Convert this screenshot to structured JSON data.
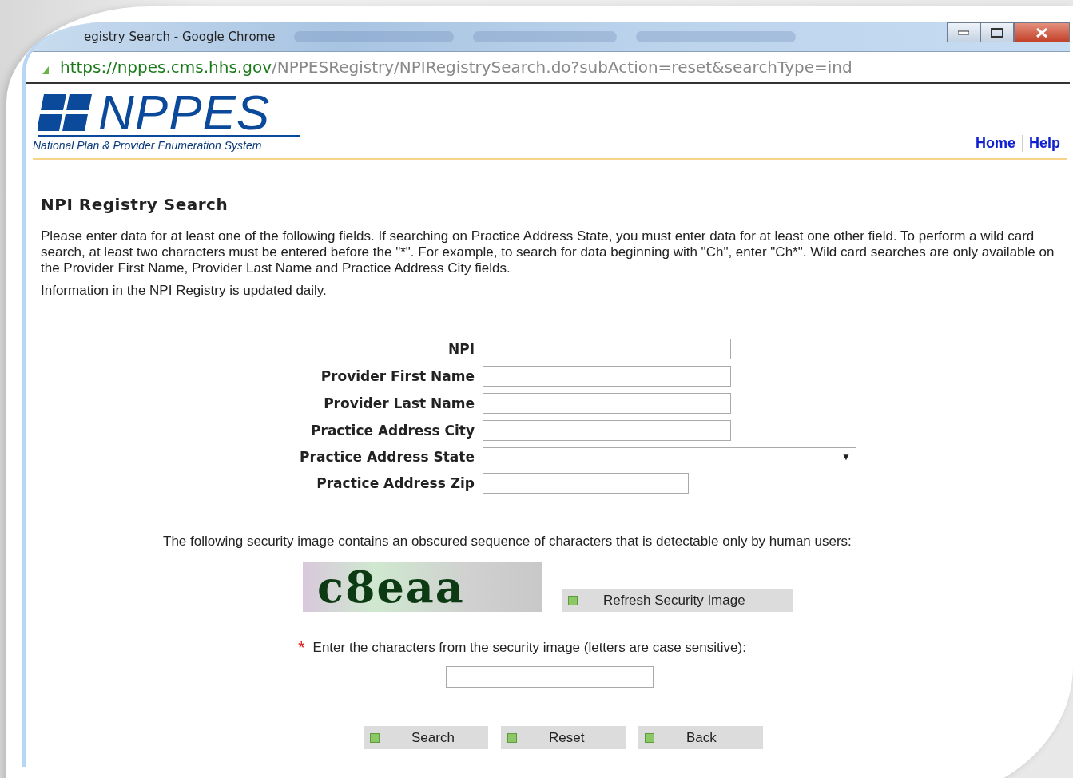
{
  "window": {
    "title": "egistry Search - Google Chrome",
    "address": {
      "host": "https://nppes.cms.hhs.gov",
      "path": "/NPPESRegistry/NPIRegistrySearch.do?subAction=reset&searchType=ind"
    }
  },
  "header": {
    "logo": "NPPES",
    "tagline": "National Plan & Provider Enumeration System",
    "links": [
      "Home",
      "Help"
    ]
  },
  "page": {
    "heading": "NPI Registry Search",
    "instructions": "Please enter data for at least one of the following fields. If searching on Practice Address State, you must enter data for at least one other field. To perform a wild card search, at least two characters must be entered before the \"*\". For example, to search for data beginning with \"Ch\", enter \"Ch*\". Wild card searches are only available on the Provider First Name, Provider Last Name and Practice Address City fields.",
    "note": "Information in the NPI Registry is updated daily."
  },
  "fields": [
    {
      "label": "NPI",
      "kind": "text"
    },
    {
      "label": "Provider First Name",
      "kind": "text"
    },
    {
      "label": "Provider Last Name",
      "kind": "text"
    },
    {
      "label": "Practice Address City",
      "kind": "text"
    },
    {
      "label": "Practice Address State",
      "kind": "select",
      "arrow": "▼"
    },
    {
      "label": "Practice Address Zip",
      "kind": "short"
    }
  ],
  "security": {
    "text": "The following security image contains an obscured sequence of characters that is detectable only by human users:",
    "image_text": "c8eaa",
    "refresh_button": "Refresh Security Image",
    "required_mark": "*",
    "prompt": "Enter the characters from the security image (letters are case sensitive):"
  },
  "buttons": [
    "Search",
    "Reset",
    "Back"
  ]
}
